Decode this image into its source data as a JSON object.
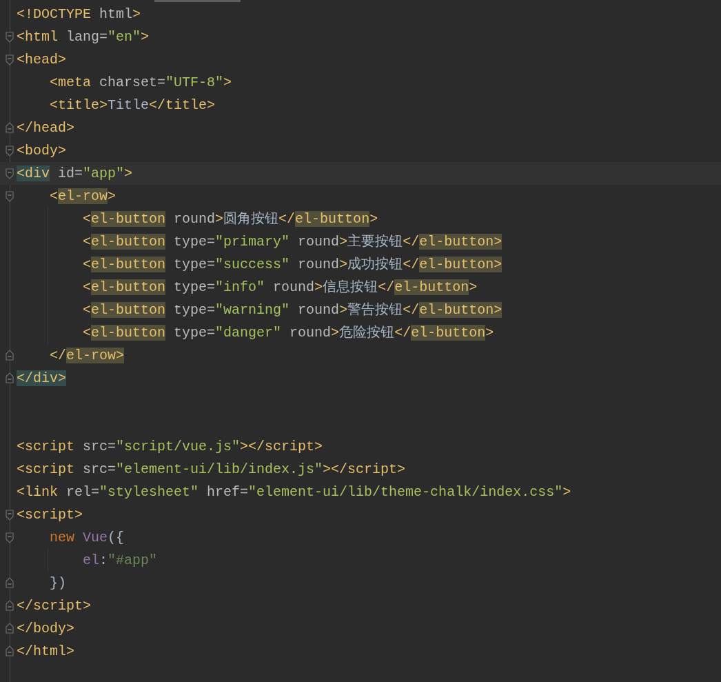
{
  "editor": {
    "lines": [
      {
        "kind": "plain",
        "tokens": [
          {
            "text": "<!DOCTYPE ",
            "kind": "tag"
          },
          {
            "text": "html",
            "kind": "attr"
          },
          {
            "text": ">",
            "kind": "tag"
          }
        ]
      },
      {
        "kind": "fold-open",
        "tokens": [
          {
            "text": "<html ",
            "kind": "tag"
          },
          {
            "text": "lang=",
            "kind": "attr"
          },
          {
            "text": "\"en\"",
            "kind": "value"
          },
          {
            "text": ">",
            "kind": "tag"
          }
        ]
      },
      {
        "kind": "fold-open",
        "tokens": [
          {
            "text": "<head>",
            "kind": "tag"
          }
        ]
      },
      {
        "kind": "plain",
        "tokens": [
          {
            "text": "    <meta ",
            "kind": "tag"
          },
          {
            "text": "charset=",
            "kind": "attr"
          },
          {
            "text": "\"UTF-8\"",
            "kind": "value"
          },
          {
            "text": ">",
            "kind": "tag"
          }
        ]
      },
      {
        "kind": "plain",
        "tokens": [
          {
            "text": "    <title>",
            "kind": "tag"
          },
          {
            "text": "Title",
            "kind": "text"
          },
          {
            "text": "</title>",
            "kind": "tag"
          }
        ]
      },
      {
        "kind": "fold-close",
        "tokens": [
          {
            "text": "</head>",
            "kind": "tag"
          }
        ]
      },
      {
        "kind": "fold-open",
        "tokens": [
          {
            "text": "<body>",
            "kind": "tag"
          }
        ]
      },
      {
        "kind": "fold-open",
        "current": true,
        "tokens": [
          {
            "text": "<div",
            "kind": "pair"
          },
          {
            "text": " id=",
            "kind": "attr"
          },
          {
            "text": "\"app\"",
            "kind": "value"
          },
          {
            "text": ">",
            "kind": "tag"
          }
        ]
      },
      {
        "kind": "fold-open",
        "tokens": [
          {
            "text": "    <",
            "kind": "tag"
          },
          {
            "text": "el-row",
            "kind": "match"
          },
          {
            "text": ">",
            "kind": "tag"
          }
        ]
      },
      {
        "kind": "plain",
        "guide": true,
        "tokens": [
          {
            "text": "        <",
            "kind": "tag"
          },
          {
            "text": "el-button",
            "kind": "match"
          },
          {
            "text": " round",
            "kind": "attr"
          },
          {
            "text": ">",
            "kind": "tag"
          },
          {
            "text": "圆角按钮",
            "kind": "text"
          },
          {
            "text": "</",
            "kind": "tag"
          },
          {
            "text": "el-button",
            "kind": "match"
          },
          {
            "text": ">",
            "kind": "tag"
          }
        ]
      },
      {
        "kind": "plain",
        "guide": true,
        "tokens": [
          {
            "text": "        <",
            "kind": "tag"
          },
          {
            "text": "el-button",
            "kind": "match"
          },
          {
            "text": " type=",
            "kind": "attr"
          },
          {
            "text": "\"primary\"",
            "kind": "value"
          },
          {
            "text": " round",
            "kind": "attr"
          },
          {
            "text": ">",
            "kind": "tag"
          },
          {
            "text": "主要按钮",
            "kind": "text"
          },
          {
            "text": "</",
            "kind": "tag"
          },
          {
            "text": "el-button>",
            "kind": "match"
          }
        ]
      },
      {
        "kind": "plain",
        "guide": true,
        "tokens": [
          {
            "text": "        <",
            "kind": "tag"
          },
          {
            "text": "el-button",
            "kind": "match"
          },
          {
            "text": " type=",
            "kind": "attr"
          },
          {
            "text": "\"success\"",
            "kind": "value"
          },
          {
            "text": " round",
            "kind": "attr"
          },
          {
            "text": ">",
            "kind": "tag"
          },
          {
            "text": "成功按钮",
            "kind": "text"
          },
          {
            "text": "</",
            "kind": "tag"
          },
          {
            "text": "el-button>",
            "kind": "match"
          }
        ]
      },
      {
        "kind": "plain",
        "guide": true,
        "tokens": [
          {
            "text": "        <",
            "kind": "tag"
          },
          {
            "text": "el-button",
            "kind": "match"
          },
          {
            "text": " type=",
            "kind": "attr"
          },
          {
            "text": "\"info\"",
            "kind": "value"
          },
          {
            "text": " round",
            "kind": "attr"
          },
          {
            "text": ">",
            "kind": "tag"
          },
          {
            "text": "信息按钮",
            "kind": "text"
          },
          {
            "text": "</",
            "kind": "tag"
          },
          {
            "text": "el-button",
            "kind": "match"
          },
          {
            "text": ">",
            "kind": "tag"
          }
        ]
      },
      {
        "kind": "plain",
        "guide": true,
        "tokens": [
          {
            "text": "        <",
            "kind": "tag"
          },
          {
            "text": "el-button",
            "kind": "match"
          },
          {
            "text": " type=",
            "kind": "attr"
          },
          {
            "text": "\"warning\"",
            "kind": "value"
          },
          {
            "text": " round",
            "kind": "attr"
          },
          {
            "text": ">",
            "kind": "tag"
          },
          {
            "text": "警告按钮",
            "kind": "text"
          },
          {
            "text": "</",
            "kind": "tag"
          },
          {
            "text": "el-button>",
            "kind": "match"
          }
        ]
      },
      {
        "kind": "plain",
        "guide": true,
        "tokens": [
          {
            "text": "        <",
            "kind": "tag"
          },
          {
            "text": "el-button",
            "kind": "match"
          },
          {
            "text": " type=",
            "kind": "attr"
          },
          {
            "text": "\"danger\"",
            "kind": "value"
          },
          {
            "text": " round",
            "kind": "attr"
          },
          {
            "text": ">",
            "kind": "tag"
          },
          {
            "text": "危险按钮",
            "kind": "text"
          },
          {
            "text": "</",
            "kind": "tag"
          },
          {
            "text": "el-button",
            "kind": "match"
          },
          {
            "text": ">",
            "kind": "tag"
          }
        ]
      },
      {
        "kind": "fold-close",
        "tokens": [
          {
            "text": "    </",
            "kind": "tag"
          },
          {
            "text": "el-row>",
            "kind": "match"
          }
        ]
      },
      {
        "kind": "fold-close",
        "tokens": [
          {
            "text": "</div>",
            "kind": "pair"
          }
        ]
      },
      {
        "kind": "blank"
      },
      {
        "kind": "blank"
      },
      {
        "kind": "plain",
        "tokens": [
          {
            "text": "<script ",
            "kind": "tag"
          },
          {
            "text": "src=",
            "kind": "attr"
          },
          {
            "text": "\"script/vue.js\"",
            "kind": "value"
          },
          {
            "text": "></script>",
            "kind": "tag"
          }
        ]
      },
      {
        "kind": "plain",
        "tokens": [
          {
            "text": "<script ",
            "kind": "tag"
          },
          {
            "text": "src=",
            "kind": "attr"
          },
          {
            "text": "\"element-ui/lib/index.js\"",
            "kind": "value"
          },
          {
            "text": "></script>",
            "kind": "tag"
          }
        ]
      },
      {
        "kind": "plain",
        "tokens": [
          {
            "text": "<link ",
            "kind": "tag"
          },
          {
            "text": "rel=",
            "kind": "attr"
          },
          {
            "text": "\"stylesheet\"",
            "kind": "value"
          },
          {
            "text": " href=",
            "kind": "attr"
          },
          {
            "text": "\"element-ui/lib/theme-chalk/index.css\"",
            "kind": "value"
          },
          {
            "text": ">",
            "kind": "tag"
          }
        ]
      },
      {
        "kind": "fold-open",
        "tokens": [
          {
            "text": "<script>",
            "kind": "tag"
          }
        ]
      },
      {
        "kind": "fold-open",
        "tokens": [
          {
            "text": "    new ",
            "kind": "keyword"
          },
          {
            "text": "Vue",
            "kind": "func"
          },
          {
            "text": "({",
            "kind": "punct"
          }
        ]
      },
      {
        "kind": "plain",
        "guide": true,
        "tokens": [
          {
            "text": "        el",
            "kind": "prop"
          },
          {
            "text": ":",
            "kind": "punct"
          },
          {
            "text": "\"#app\"",
            "kind": "string"
          }
        ]
      },
      {
        "kind": "fold-close",
        "tokens": [
          {
            "text": "    })",
            "kind": "punct"
          }
        ]
      },
      {
        "kind": "fold-close",
        "tokens": [
          {
            "text": "</script>",
            "kind": "tag"
          }
        ]
      },
      {
        "kind": "fold-close",
        "tokens": [
          {
            "text": "</body>",
            "kind": "tag"
          }
        ]
      },
      {
        "kind": "fold-close",
        "tokens": [
          {
            "text": "</html>",
            "kind": "tag"
          }
        ]
      }
    ]
  }
}
